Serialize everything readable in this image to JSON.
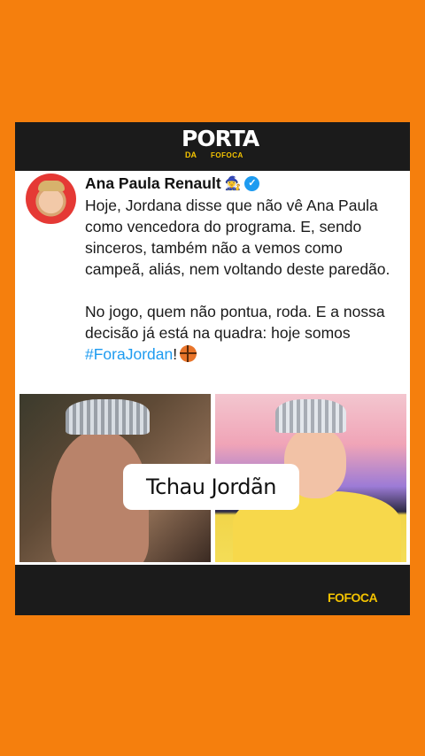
{
  "colors": {
    "background": "#F57F0D",
    "bar": "#1b1b1b",
    "brand_yellow": "#F5C400",
    "link_blue": "#1D9BF0"
  },
  "header": {
    "logo_main": "PORTA",
    "logo_da": "DA",
    "logo_fofoca": "FOFOCA"
  },
  "tweet": {
    "author": "Ana Paula Renault",
    "author_emoji": "🧙‍♀️",
    "verified_icon": "verified-badge-icon",
    "paragraph_1": "Hoje, Jordana disse que não vê Ana Paula como vencedora do programa. E, sendo sinceros, também não a vemos como campeã, aliás, nem voltando deste paredão.",
    "paragraph_2_prefix": "No jogo, quem não pontua, roda. E a nossa decisão já está na quadra: hoje somos ",
    "hashtag": "#ForaJordan",
    "paragraph_2_suffix": "!",
    "trailing_icon": "basketball-icon"
  },
  "overlay": {
    "caption": "Tchau Jordãn"
  },
  "footer": {
    "brand": "FOFOCA"
  }
}
